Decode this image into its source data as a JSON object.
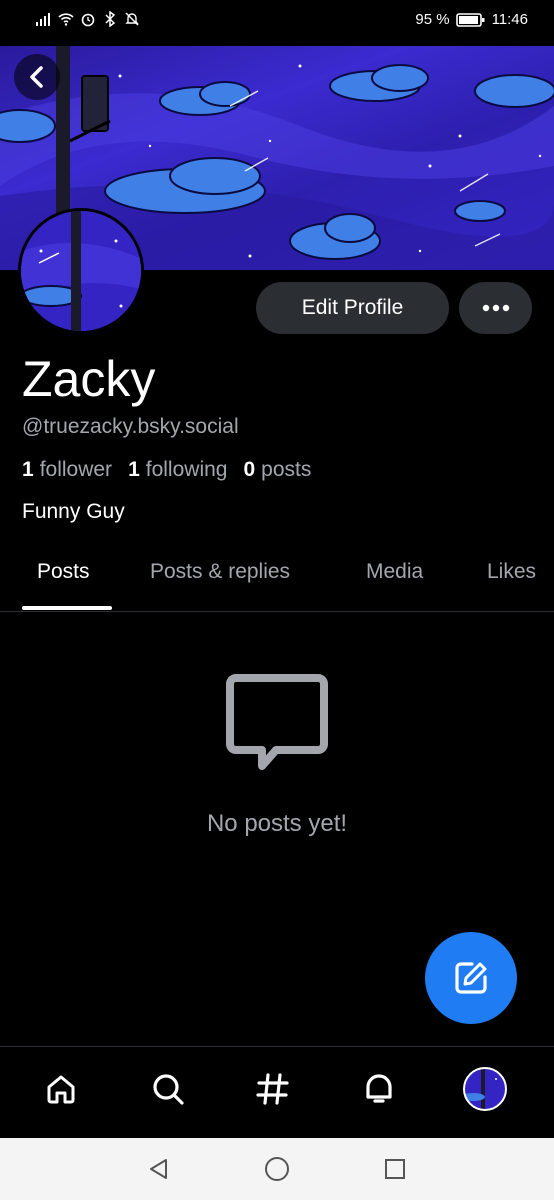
{
  "status_bar": {
    "battery": "95 %",
    "time": "11:46"
  },
  "profile": {
    "display_name": "Zacky",
    "handle": "@truezacky.bsky.social",
    "followers_count": "1",
    "followers_label": "follower",
    "following_count": "1",
    "following_label": "following",
    "posts_count": "0",
    "posts_label": "posts",
    "bio": "Funny Guy"
  },
  "actions": {
    "edit_profile_label": "Edit Profile"
  },
  "tabs": [
    {
      "label": "Posts",
      "active": true
    },
    {
      "label": "Posts & replies",
      "active": false
    },
    {
      "label": "Media",
      "active": false
    },
    {
      "label": "Likes",
      "active": false
    }
  ],
  "feed": {
    "empty_message": "No posts yet!"
  },
  "colors": {
    "accent": "#1f7cf2",
    "background": "#000000",
    "button_bg": "#2b2e33",
    "muted_text": "#a3a7ad",
    "banner": "#3424c4"
  },
  "icons": {
    "back": "chevron-left-icon",
    "more": "ellipsis-icon",
    "empty": "message-bubble-icon",
    "compose": "compose-icon",
    "nav": [
      "home-icon",
      "search-icon",
      "hashtag-icon",
      "bell-icon",
      "avatar"
    ],
    "system": [
      "triangle-back-icon",
      "circle-home-icon",
      "square-recents-icon"
    ]
  }
}
